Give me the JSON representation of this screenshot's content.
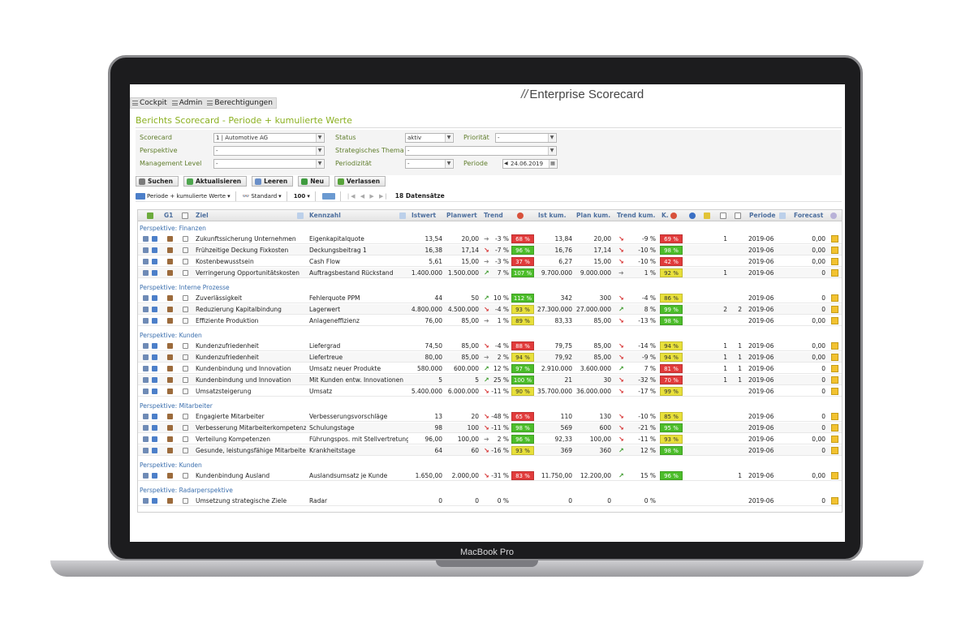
{
  "device": {
    "brand_label": "MacBook Pro"
  },
  "menu": [
    {
      "label": "Cockpit"
    },
    {
      "label": "Admin"
    },
    {
      "label": "Berechtigungen"
    }
  ],
  "brand": {
    "slash": "//",
    "title": "Enterprise Scorecard"
  },
  "page_title": "Berichts Scorecard - Periode + kumulierte Werte",
  "filters": {
    "scorecard_label": "Scorecard",
    "scorecard_value": "1 | Automotive AG",
    "perspektive_label": "Perspektive",
    "perspektive_value": "-",
    "management_label": "Management Level",
    "management_value": "-",
    "status_label": "Status",
    "status_value": "aktiv",
    "thema_label": "Strategisches Thema",
    "thema_value": "-",
    "periodizitat_label": "Periodizität",
    "periodizitat_value": "-",
    "prioritat_label": "Priorität",
    "prioritat_value": "-",
    "periode_label": "Periode",
    "periode_value": "24.06.2019"
  },
  "buttons": [
    {
      "label": "Suchen",
      "color": "#7a7a7a"
    },
    {
      "label": "Aktualisieren",
      "color": "#4ea64e"
    },
    {
      "label": "Leeren",
      "color": "#6a8fc8"
    },
    {
      "label": "Neu",
      "color": "#3f9b3f"
    },
    {
      "label": "Verlassen",
      "color": "#57a33a"
    }
  ],
  "toolbar": {
    "view": "Periode + kumulierte Werte",
    "layout": "Standard",
    "page_size": "100",
    "pager": "|◀ ◀ ▶ ▶|",
    "count": "18 Datensätze"
  },
  "headers": {
    "g1": "G1",
    "ziel": "Ziel",
    "kennzahl": "Kennzahl",
    "istwert": "Istwert",
    "planwert": "Planwert",
    "trend": "Trend",
    "ist_kum": "Ist kum.",
    "plan_kum": "Plan kum.",
    "trend_kum": "Trend kum.",
    "k": "K.",
    "periode": "Periode",
    "forecast": "Forecast"
  },
  "sections": [
    {
      "title": "Perspektive: Finanzen",
      "rows": [
        {
          "ziel": "Zukunftssicherung Unternehmen",
          "kennzahl": "Eigenkapitalquote",
          "istwert": "13,54",
          "planwert": "20,00",
          "trend_dir": "right",
          "trend": "-3 %",
          "grad": "68 %",
          "grad_color": "#e13b3b",
          "ist_kum": "13,84",
          "plan_kum": "20,00",
          "tk_dir": "down-red",
          "trend_kum": "-9 %",
          "kgrad": "69 %",
          "kgrad_color": "#e13b3b",
          "c1": "1",
          "c2": "",
          "periode": "2019-06",
          "forecast": "0,00"
        },
        {
          "ziel": "Frühzeitige Deckung Fixkosten",
          "kennzahl": "Deckungsbeitrag 1",
          "istwert": "16,38",
          "planwert": "17,14",
          "trend_dir": "down-red",
          "trend": "-7 %",
          "grad": "96 %",
          "grad_color": "#4cbd2a",
          "ist_kum": "16,76",
          "plan_kum": "17,14",
          "tk_dir": "down-red",
          "trend_kum": "-10 %",
          "kgrad": "98 %",
          "kgrad_color": "#4cbd2a",
          "c1": "",
          "c2": "",
          "periode": "2019-06",
          "forecast": "0,00"
        },
        {
          "ziel": "Kostenbewusstsein",
          "kennzahl": "Cash Flow",
          "istwert": "5,61",
          "planwert": "15,00",
          "trend_dir": "right",
          "trend": "-3 %",
          "grad": "37 %",
          "grad_color": "#e13b3b",
          "ist_kum": "6,27",
          "plan_kum": "15,00",
          "tk_dir": "down-red",
          "trend_kum": "-10 %",
          "kgrad": "42 %",
          "kgrad_color": "#e13b3b",
          "c1": "",
          "c2": "",
          "periode": "2019-06",
          "forecast": "0,00"
        },
        {
          "ziel": "Verringerung Opportunitätskosten",
          "kennzahl": "Auftragsbestand Rückstand",
          "istwert": "1.400.000",
          "planwert": "1.500.000",
          "trend_dir": "up-green",
          "trend": "7 %",
          "grad": "107 %",
          "grad_color": "#4cbd2a",
          "ist_kum": "9.700.000",
          "plan_kum": "9.000.000",
          "tk_dir": "right",
          "trend_kum": "1 %",
          "kgrad": "92 %",
          "kgrad_color": "#e8e03a",
          "c1": "1",
          "c2": "",
          "periode": "2019-06",
          "forecast": "0"
        }
      ]
    },
    {
      "title": "Perspektive: Interne Prozesse",
      "rows": [
        {
          "ziel": "Zuverlässigkeit",
          "kennzahl": "Fehlerquote PPM",
          "istwert": "44",
          "planwert": "50",
          "trend_dir": "up-green",
          "trend": "10 %",
          "grad": "112 %",
          "grad_color": "#4cbd2a",
          "ist_kum": "342",
          "plan_kum": "300",
          "tk_dir": "down-red",
          "trend_kum": "-4 %",
          "kgrad": "86 %",
          "kgrad_color": "#e8e03a",
          "c1": "",
          "c2": "",
          "periode": "2019-06",
          "forecast": "0"
        },
        {
          "ziel": "Reduzierung Kapitalbindung",
          "kennzahl": "Lagerwert",
          "istwert": "4.800.000",
          "planwert": "4.500.000",
          "trend_dir": "down-red",
          "trend": "-4 %",
          "grad": "93 %",
          "grad_color": "#e8e03a",
          "ist_kum": "27.300.000",
          "plan_kum": "27.000.000",
          "tk_dir": "up-green",
          "trend_kum": "8 %",
          "kgrad": "99 %",
          "kgrad_color": "#4cbd2a",
          "c1": "2",
          "c2": "2",
          "periode": "2019-06",
          "forecast": "0"
        },
        {
          "ziel": "Effiziente Produktion",
          "kennzahl": "Anlageneffizienz",
          "istwert": "76,00",
          "planwert": "85,00",
          "trend_dir": "right",
          "trend": "1 %",
          "grad": "89 %",
          "grad_color": "#e8e03a",
          "ist_kum": "83,33",
          "plan_kum": "85,00",
          "tk_dir": "down-red",
          "trend_kum": "-13 %",
          "kgrad": "98 %",
          "kgrad_color": "#4cbd2a",
          "c1": "",
          "c2": "",
          "periode": "2019-06",
          "forecast": "0,00"
        }
      ]
    },
    {
      "title": "Perspektive: Kunden",
      "rows": [
        {
          "ziel": "Kundenzufriedenheit",
          "kennzahl": "Liefergrad",
          "istwert": "74,50",
          "planwert": "85,00",
          "trend_dir": "down-red",
          "trend": "-4 %",
          "grad": "88 %",
          "grad_color": "#e13b3b",
          "ist_kum": "79,75",
          "plan_kum": "85,00",
          "tk_dir": "down-red",
          "trend_kum": "-14 %",
          "kgrad": "94 %",
          "kgrad_color": "#e8e03a",
          "c1": "1",
          "c2": "1",
          "periode": "2019-06",
          "forecast": "0,00"
        },
        {
          "ziel": "Kundenzufriedenheit",
          "kennzahl": "Liefertreue",
          "istwert": "80,00",
          "planwert": "85,00",
          "trend_dir": "right",
          "trend": "2 %",
          "grad": "94 %",
          "grad_color": "#e8e03a",
          "ist_kum": "79,92",
          "plan_kum": "85,00",
          "tk_dir": "down-red",
          "trend_kum": "-9 %",
          "kgrad": "94 %",
          "kgrad_color": "#e8e03a",
          "c1": "1",
          "c2": "1",
          "periode": "2019-06",
          "forecast": "0,00"
        },
        {
          "ziel": "Kundenbindung und Innovation",
          "kennzahl": "Umsatz neuer Produkte",
          "istwert": "580.000",
          "planwert": "600.000",
          "trend_dir": "up-green",
          "trend": "12 %",
          "grad": "97 %",
          "grad_color": "#4cbd2a",
          "ist_kum": "2.910.000",
          "plan_kum": "3.600.000",
          "tk_dir": "up-green",
          "trend_kum": "7 %",
          "kgrad": "81 %",
          "kgrad_color": "#e13b3b",
          "c1": "1",
          "c2": "1",
          "periode": "2019-06",
          "forecast": "0"
        },
        {
          "ziel": "Kundenbindung und Innovation",
          "kennzahl": "Mit Kunden entw. Innovationen",
          "istwert": "5",
          "planwert": "5",
          "trend_dir": "up-green",
          "trend": "25 %",
          "grad": "100 %",
          "grad_color": "#4cbd2a",
          "ist_kum": "21",
          "plan_kum": "30",
          "tk_dir": "down-red",
          "trend_kum": "-32 %",
          "kgrad": "70 %",
          "kgrad_color": "#e13b3b",
          "c1": "1",
          "c2": "1",
          "periode": "2019-06",
          "forecast": "0"
        },
        {
          "ziel": "Umsatzsteigerung",
          "kennzahl": "Umsatz",
          "istwert": "5.400.000",
          "planwert": "6.000.000",
          "trend_dir": "down-red",
          "trend": "-11 %",
          "grad": "90 %",
          "grad_color": "#e8e03a",
          "ist_kum": "35.700.000",
          "plan_kum": "36.000.000",
          "tk_dir": "down-red",
          "trend_kum": "-17 %",
          "kgrad": "99 %",
          "kgrad_color": "#e8e03a",
          "c1": "",
          "c2": "",
          "periode": "2019-06",
          "forecast": "0"
        }
      ]
    },
    {
      "title": "Perspektive: Mitarbeiter",
      "rows": [
        {
          "ziel": "Engagierte Mitarbeiter",
          "kennzahl": "Verbesserungsvorschläge",
          "istwert": "13",
          "planwert": "20",
          "trend_dir": "down-red",
          "trend": "-48 %",
          "grad": "65 %",
          "grad_color": "#e13b3b",
          "ist_kum": "110",
          "plan_kum": "130",
          "tk_dir": "down-red",
          "trend_kum": "-10 %",
          "kgrad": "85 %",
          "kgrad_color": "#e8e03a",
          "c1": "",
          "c2": "",
          "periode": "2019-06",
          "forecast": "0"
        },
        {
          "ziel": "Verbesserung Mitarbeiterkompetenz",
          "kennzahl": "Schulungstage",
          "istwert": "98",
          "planwert": "100",
          "trend_dir": "down-red",
          "trend": "-11 %",
          "grad": "98 %",
          "grad_color": "#4cbd2a",
          "ist_kum": "569",
          "plan_kum": "600",
          "tk_dir": "down-red",
          "trend_kum": "-21 %",
          "kgrad": "95 %",
          "kgrad_color": "#4cbd2a",
          "c1": "",
          "c2": "",
          "periode": "2019-06",
          "forecast": "0"
        },
        {
          "ziel": "Verteilung Kompetenzen",
          "kennzahl": "Führungspos. mit Stellvertretung",
          "istwert": "96,00",
          "planwert": "100,00",
          "trend_dir": "right",
          "trend": "2 %",
          "grad": "96 %",
          "grad_color": "#4cbd2a",
          "ist_kum": "92,33",
          "plan_kum": "100,00",
          "tk_dir": "down-red",
          "trend_kum": "-11 %",
          "kgrad": "93 %",
          "kgrad_color": "#e8e03a",
          "c1": "",
          "c2": "",
          "periode": "2019-06",
          "forecast": "0,00"
        },
        {
          "ziel": "Gesunde, leistungsfähige Mitarbeiter",
          "kennzahl": "Krankheitstage",
          "istwert": "64",
          "planwert": "60",
          "trend_dir": "down-red",
          "trend": "-16 %",
          "grad": "93 %",
          "grad_color": "#e8e03a",
          "ist_kum": "369",
          "plan_kum": "360",
          "tk_dir": "up-green",
          "trend_kum": "12 %",
          "kgrad": "98 %",
          "kgrad_color": "#4cbd2a",
          "c1": "",
          "c2": "",
          "periode": "2019-06",
          "forecast": "0"
        }
      ]
    },
    {
      "title": "Perspektive: Kunden",
      "rows": [
        {
          "ziel": "Kundenbindung Ausland",
          "kennzahl": "Auslandsumsatz je Kunde",
          "istwert": "1.650,00",
          "planwert": "2.000,00",
          "trend_dir": "down-red",
          "trend": "-31 %",
          "grad": "83 %",
          "grad_color": "#e13b3b",
          "ist_kum": "11.750,00",
          "plan_kum": "12.200,00",
          "tk_dir": "up-green",
          "trend_kum": "15 %",
          "kgrad": "96 %",
          "kgrad_color": "#4cbd2a",
          "c1": "",
          "c2": "1",
          "periode": "2019-06",
          "forecast": "0,00"
        }
      ]
    },
    {
      "title": "Perspektive: Radarperspektive",
      "rows": [
        {
          "ziel": "Umsetzung strategische Ziele",
          "kennzahl": "Radar",
          "istwert": "0",
          "planwert": "0",
          "trend_dir": "",
          "trend": "0 %",
          "grad": "",
          "grad_color": "",
          "ist_kum": "0",
          "plan_kum": "0",
          "tk_dir": "",
          "trend_kum": "0 %",
          "kgrad": "",
          "kgrad_color": "",
          "c1": "",
          "c2": "",
          "periode": "2019-06",
          "forecast": "0"
        }
      ]
    }
  ],
  "colors": {
    "title_green": "#8bb021",
    "link_blue": "#3b6fae",
    "red": "#e13b3b",
    "yellow": "#e8e03a",
    "green": "#4cbd2a"
  }
}
